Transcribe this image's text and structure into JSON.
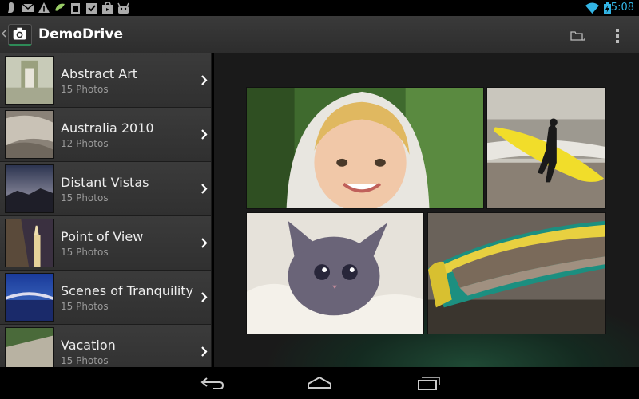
{
  "status_bar": {
    "time": "5:08",
    "left_icons": [
      "notification-icon",
      "mail-icon",
      "warning-icon",
      "app-icon",
      "clipboard-icon",
      "check-icon",
      "shopping-icon",
      "android-icon"
    ],
    "right_icons": [
      "wifi-icon",
      "battery-icon"
    ]
  },
  "action_bar": {
    "title": "DemoDrive",
    "icon": "camera-icon",
    "actions": [
      "cloud-folder-icon",
      "overflow-menu-icon"
    ]
  },
  "albums": [
    {
      "title": "Abstract Art",
      "count": "15 Photos"
    },
    {
      "title": "Australia 2010",
      "count": "12 Photos"
    },
    {
      "title": "Distant Vistas",
      "count": "15 Photos"
    },
    {
      "title": "Point of View",
      "count": "15 Photos"
    },
    {
      "title": "Scenes of Tranquility",
      "count": "15 Photos"
    },
    {
      "title": "Vacation",
      "count": "15 Photos"
    }
  ],
  "photos": [
    "child-in-hood-photo",
    "surfer-photo",
    "kitten-photo",
    "boat-photo"
  ],
  "nav_bar": [
    "back-icon",
    "home-icon",
    "recent-apps-icon"
  ],
  "colors": {
    "accent": "#2e8b57",
    "background": "#262626"
  }
}
